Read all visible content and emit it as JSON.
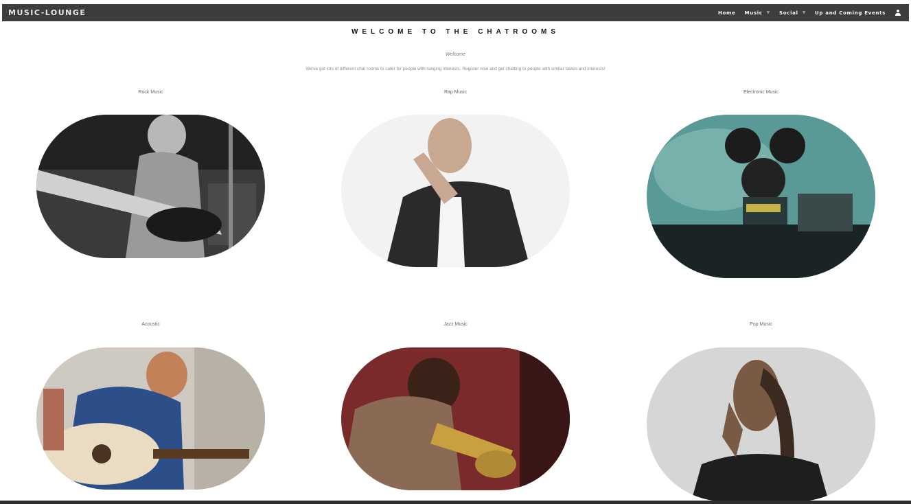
{
  "navbar": {
    "brand": "MUSIC-LOUNGE",
    "items": [
      {
        "label": "Home"
      },
      {
        "label": "Music"
      },
      {
        "label": "Social"
      },
      {
        "label": "Up and Coming Events"
      }
    ],
    "user_icon": "user-icon"
  },
  "main": {
    "title": "WELCOME TO THE CHATROOMS",
    "welcome": "Welcome",
    "intro": "We've got lots of different chat rooms to cater for people with ranging interests. Register now and get chatting to people with similar tastes and interests!"
  },
  "rooms": [
    {
      "label": "Rock Music",
      "image": "rock-guitarist-photo"
    },
    {
      "label": "Rap Music",
      "image": "rap-artist-photo"
    },
    {
      "label": "Electronic Music",
      "image": "electronic-dj-photo"
    },
    {
      "label": "Acoustic",
      "image": "acoustic-guitarist-photo"
    },
    {
      "label": "Jazz Music",
      "image": "jazz-trumpeter-photo"
    },
    {
      "label": "Pop Music",
      "image": "pop-singer-photo"
    }
  ],
  "colors": {
    "navbar": "#3d3d3d",
    "background": "#ffffff"
  }
}
